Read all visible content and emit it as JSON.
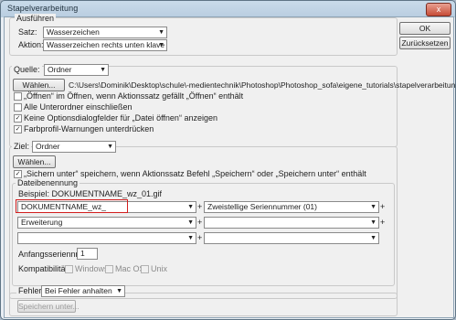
{
  "window": {
    "title": "Stapelverarbeitung",
    "close_glyph": "x"
  },
  "buttons": {
    "ok": "OK",
    "reset": "Zurücksetzen"
  },
  "play": {
    "legend": "Ausführen",
    "set_label": "Satz:",
    "set_value": "Wasserzeichen",
    "action_label": "Aktion:",
    "action_value": "Wasserzeichen rechts unten klave"
  },
  "source": {
    "label": "Quelle:",
    "value": "Ordner",
    "choose_button": "Wählen...",
    "path": "C:\\Users\\Dominik\\Desktop\\schule\\-medientechnik\\Photoshop\\Photoshop_sofa\\eigene_tutorials\\stapelverarbeitung\\",
    "options": [
      {
        "label": "„Öffnen“ im Öffnen, wenn Aktionssatz gefällt „Öffnen“ enthält",
        "checked": false
      },
      {
        "label": "Alle Unterordner einschließen",
        "checked": false
      },
      {
        "label": "Keine Optionsdialogfelder für „Datei öffnen“ anzeigen",
        "checked": true
      },
      {
        "label": "Farbprofil-Warnungen unterdrücken",
        "checked": true
      }
    ]
  },
  "destination": {
    "label": "Ziel:",
    "value": "Ordner",
    "choose_button": "Wählen...",
    "override_label": "„Sichern unter“ speichern, wenn Aktionssatz Befehl „Speichern“ oder „Speichern unter“ enthält",
    "override_checked": true
  },
  "naming": {
    "legend": "Dateibenennung",
    "example_label": "Beispiel: DOKUMENTNAME_wz_01.gif",
    "rows": [
      {
        "left": "DOKUMENTNAME_wz_",
        "right": "Zweistellige Seriennummer (01)"
      },
      {
        "left": "Erweiterung",
        "right": ""
      },
      {
        "left": "",
        "right": ""
      }
    ],
    "start_serial_label": "Anfangsseriennr.:",
    "start_serial_value": "1",
    "compat_label": "Kompatibilität:",
    "compat": [
      {
        "label": "Windows",
        "checked": false
      },
      {
        "label": "Mac OS",
        "checked": false
      },
      {
        "label": "Unix",
        "checked": false
      }
    ]
  },
  "errors": {
    "legend": "Fehler:",
    "value": "Bei Fehler anhalten",
    "save_button": "Speichern unter..."
  },
  "icons": {
    "dropdown": "chevron-down-icon",
    "check": "checkmark-icon"
  }
}
